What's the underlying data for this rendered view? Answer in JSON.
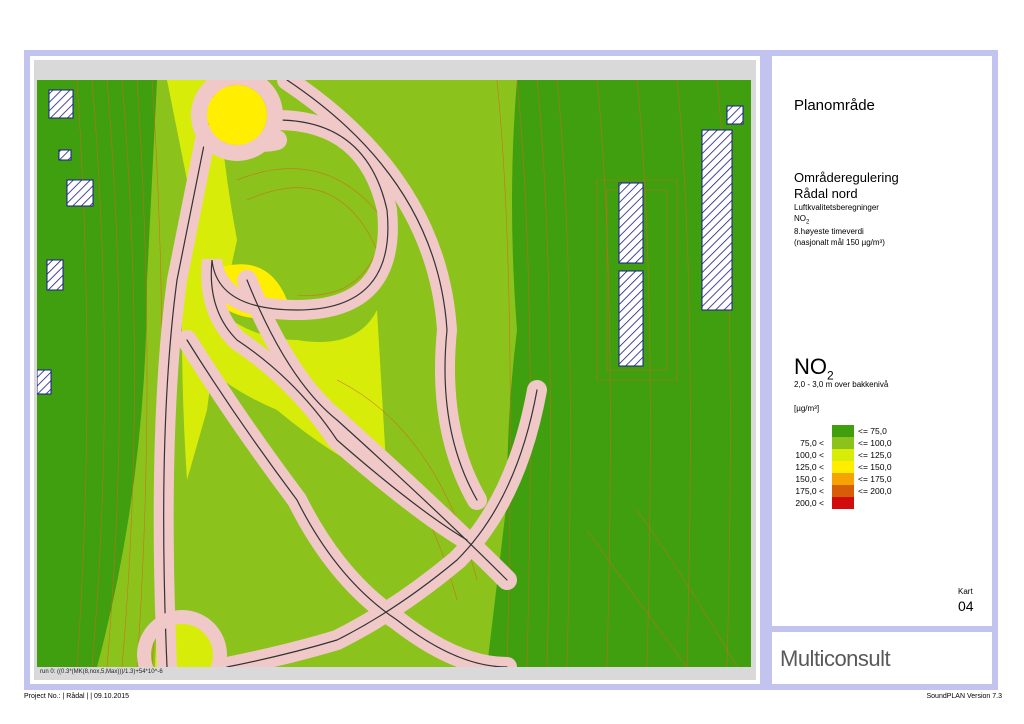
{
  "legend": {
    "title": "Planområde",
    "subtitle_1": "Områderegulering",
    "subtitle_2": "Rådal nord",
    "line_1": "Luftkvalitetsberegninger",
    "line_2_main": "NO",
    "line_2_sub": "2",
    "line_3": "8.høyeste timeverdi",
    "line_4": "(nasjonalt mål 150 µg/m³)",
    "parameter_main": "NO",
    "parameter_sub": "2",
    "height": "2,0 - 3,0 m over bakkenivå",
    "unit": "[µg/m³]",
    "classes": [
      {
        "lower": "",
        "upper": "<=   75,0",
        "color": "#3f9f0e"
      },
      {
        "lower": "75,0 <",
        "upper": "<=  100,0",
        "color": "#8bc21c"
      },
      {
        "lower": "100,0 <",
        "upper": "<=  125,0",
        "color": "#d8ec0a"
      },
      {
        "lower": "125,0 <",
        "upper": "<=  150,0",
        "color": "#ffee00"
      },
      {
        "lower": "150,0 <",
        "upper": "<=  175,0",
        "color": "#f4a300"
      },
      {
        "lower": "175,0 <",
        "upper": "<=  200,0",
        "color": "#d75d06"
      },
      {
        "lower": "200,0 <",
        "upper": "",
        "color": "#d20c0c"
      }
    ]
  },
  "kart": {
    "label": "Kart",
    "number": "04"
  },
  "logo": {
    "text": "Multiconsult"
  },
  "map": {
    "run_caption": "run 0: ((0.3*(MK(8,nox,5,Max)))/1.3)+54*10^-6"
  },
  "footer": {
    "left": "Project No.:  | Rådal |  | 09.10.2015",
    "right": "SoundPLAN Version 7.3"
  },
  "colors": {
    "frame": "#c3c3f0",
    "contour": "#d2691e",
    "road": "#f0c8c8",
    "building": "#1a1a8c"
  }
}
